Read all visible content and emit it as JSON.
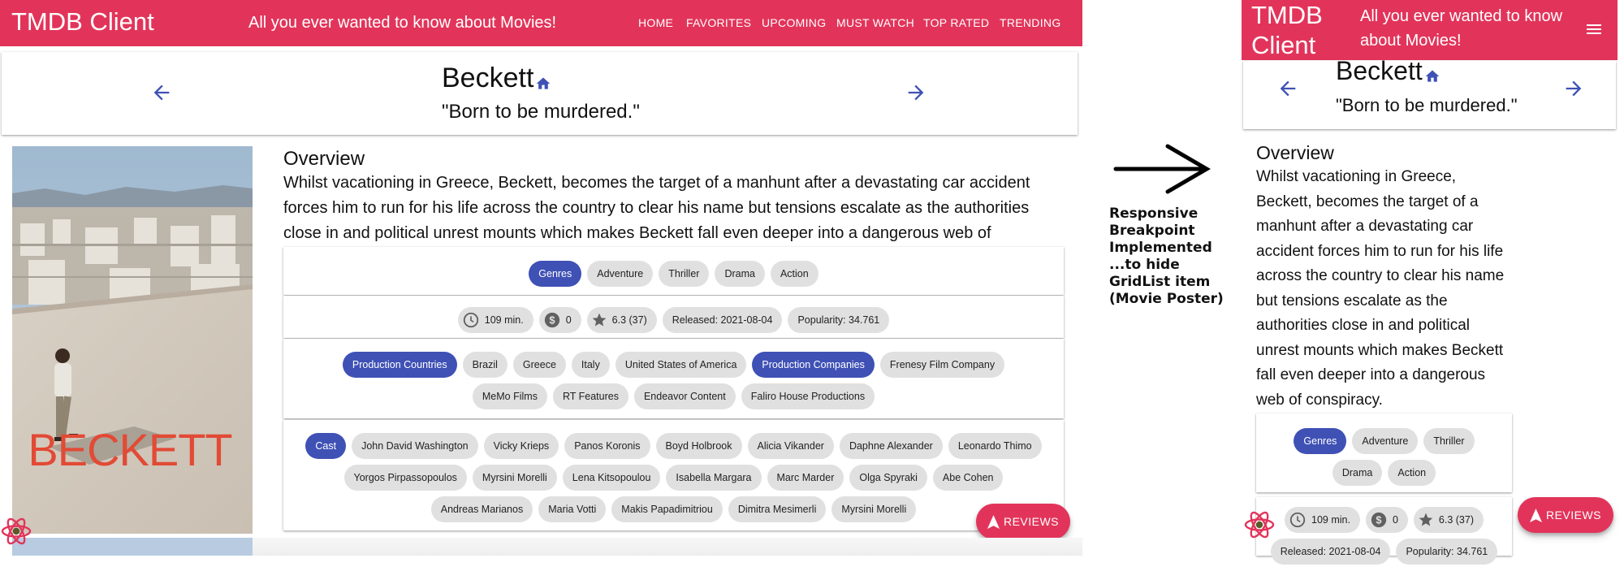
{
  "app": {
    "title": "TMDB Client",
    "tagline": "All you ever wanted to know about Movies!",
    "nav": [
      "Home",
      "Favorites",
      "Upcoming",
      "Must Watch",
      "Top Rated",
      "Trending"
    ],
    "accent": "#e2345a",
    "primary": "#3f51b5"
  },
  "movie": {
    "title": "Beckett",
    "tagline": "\"Born to be murdered.\"",
    "overview_heading": "Overview",
    "overview": "Whilst vacationing in Greece, Beckett, becomes the target of a manhunt after a devastating car accident forces him to run for his life across the country to clear his name but tensions escalate as the authorities close in and political unrest mounts which makes Beckett fall even deeper into a dangerous web of conspiracy.",
    "poster_text": "BECKETT",
    "genres_label": "Genres",
    "genres": [
      "Adventure",
      "Thriller",
      "Drama",
      "Action"
    ],
    "runtime": "109 min.",
    "revenue": "0",
    "rating": "6.3 (37)",
    "released": "Released: 2021-08-04",
    "popularity": "Popularity: 34.761",
    "countries_label": "Production Countries",
    "countries": [
      "Brazil",
      "Greece",
      "Italy",
      "United States of America"
    ],
    "companies_label": "Production Companies",
    "companies": [
      "Frenesy Film Company",
      "MeMo Films",
      "RT Features",
      "Endeavor Content",
      "Faliro House Productions"
    ],
    "cast_label": "Cast",
    "cast": [
      "John David Washington",
      "Vicky Krieps",
      "Panos Koronis",
      "Boyd Holbrook",
      "Alicia Vikander",
      "Daphne Alexander",
      "Leonardo Thimo",
      "Yorgos Pirpassopoulos",
      "Myrsini Morelli",
      "Lena Kitsopoulou",
      "Isabella Margara",
      "Marc Marder",
      "Olga Spyraki",
      "Abe Cohen",
      "Andreas Marianos",
      "Maria Votti",
      "Makis Papadimitriou",
      "Dimitra Mesimerli",
      "Myrsini Morelli"
    ]
  },
  "reviews_label": "REVIEWS",
  "annotation": "Responsive Breakpoint Implemented ...to hide GridList item (Movie Poster)",
  "mobile": {
    "brand": "TMDB Client",
    "tagline": "All you ever wanted to know about Movies!",
    "overview_lines": [
      "Whilst vacationing in Greece,",
      "Beckett, becomes the target of a",
      "manhunt after a devastating car",
      "accident forces him to run for his life",
      "across the country to clear his name",
      "but tensions escalate as the",
      "authorities close in and political",
      "unrest mounts which makes Beckett",
      "fall even deeper into a dangerous",
      "web of conspiracy."
    ]
  },
  "icons": {
    "back": "arrow-back-icon",
    "forward": "arrow-forward-icon",
    "home": "home-icon",
    "clock": "access-time-icon",
    "money": "monetization-icon",
    "star": "star-rate-icon",
    "reviews": "navigation-icon",
    "menu": "menu-icon",
    "react": "react-logo-icon"
  }
}
